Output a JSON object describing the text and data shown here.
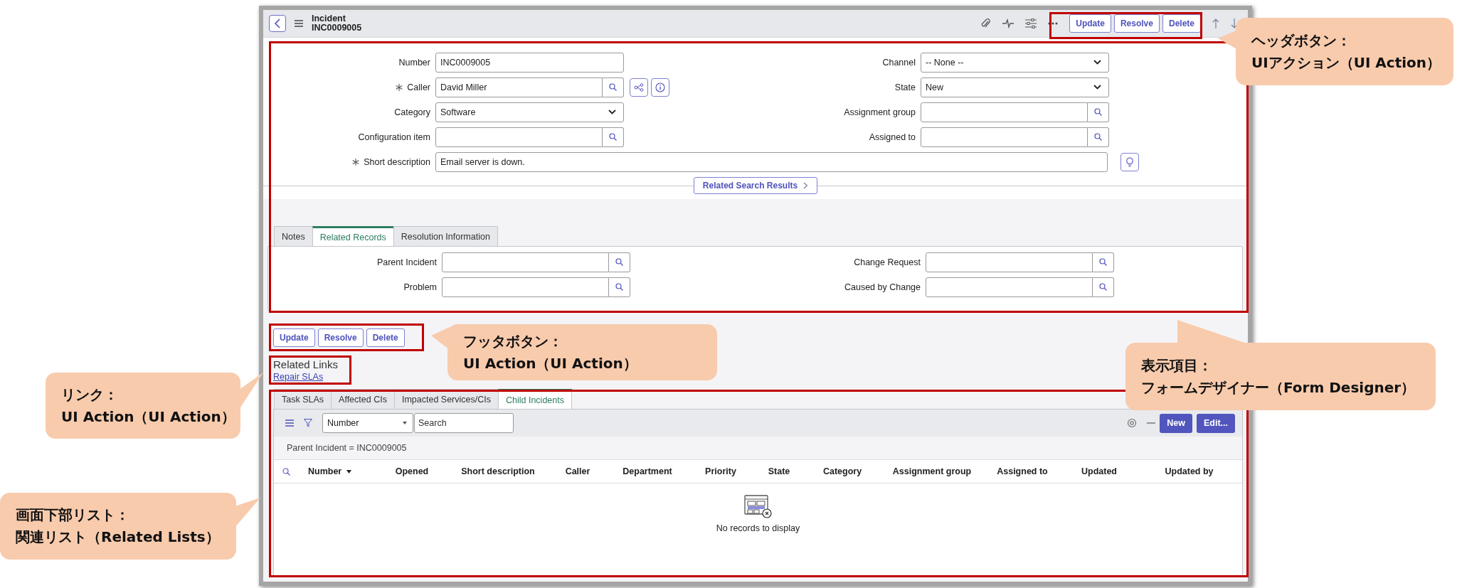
{
  "header": {
    "title": "Incident",
    "number": "INC0009005",
    "buttons": [
      "Update",
      "Resolve",
      "Delete"
    ]
  },
  "form": {
    "left": [
      {
        "label": "Number",
        "value": "INC0009005",
        "kind": "text",
        "required": false,
        "actions": false
      },
      {
        "label": "Caller",
        "value": "David Miller",
        "kind": "reference",
        "required": true,
        "actions": true
      },
      {
        "label": "Category",
        "value": "Software",
        "kind": "choice",
        "required": false,
        "actions": false
      },
      {
        "label": "Configuration item",
        "kind": "reference",
        "required": false,
        "actions": false
      }
    ],
    "right": [
      {
        "label": "Channel",
        "value": "-- None --",
        "kind": "choice",
        "required": false,
        "actions": false
      },
      {
        "label": "State",
        "value": "New",
        "kind": "choice",
        "required": false,
        "actions": false
      },
      {
        "label": "Assignment group",
        "kind": "reference",
        "required": false,
        "actions": false
      },
      {
        "label": "Assigned to",
        "kind": "reference",
        "required": false,
        "actions": false
      }
    ],
    "short_description": {
      "label": "Short description",
      "value": "Email server is down.",
      "required": true
    }
  },
  "related_search": "Related Search Results",
  "form_tabs": [
    {
      "label": "Notes",
      "selected": false
    },
    {
      "label": "Related Records",
      "selected": true
    },
    {
      "label": "Resolution Information",
      "selected": false
    }
  ],
  "tab_fields": {
    "left": [
      {
        "label": "Parent Incident",
        "kind": "reference",
        "required": false,
        "actions": false
      },
      {
        "label": "Problem",
        "kind": "reference",
        "required": false,
        "actions": false
      }
    ],
    "right": [
      {
        "label": "Change Request",
        "kind": "reference",
        "required": false,
        "actions": false
      },
      {
        "label": "Caused by Change",
        "kind": "reference",
        "required": false,
        "actions": false
      }
    ]
  },
  "footer_buttons": [
    "Update",
    "Resolve",
    "Delete"
  ],
  "related_links": {
    "title": "Related Links",
    "links": [
      "Repair SLAs"
    ]
  },
  "list_tabs": [
    {
      "label": "Task SLAs",
      "selected": false
    },
    {
      "label": "Affected CIs",
      "selected": false
    },
    {
      "label": "Impacted Services/CIs",
      "selected": false
    },
    {
      "label": "Child Incidents",
      "selected": true
    }
  ],
  "list": {
    "filter_field": "Number",
    "search_placeholder": "Search",
    "new_label": "New",
    "edit_label": "Edit...",
    "breadcrumb": "Parent Incident = INC0009005",
    "columns": [
      {
        "label": "Number",
        "sorted": true
      },
      {
        "label": "Opened",
        "sorted": false
      },
      {
        "label": "Short description",
        "sorted": false
      },
      {
        "label": "Caller",
        "sorted": false
      },
      {
        "label": "Department",
        "sorted": false
      },
      {
        "label": "Priority",
        "sorted": false
      },
      {
        "label": "State",
        "sorted": false
      },
      {
        "label": "Category",
        "sorted": false
      },
      {
        "label": "Assignment group",
        "sorted": false
      },
      {
        "label": "Assigned to",
        "sorted": false
      },
      {
        "label": "Updated",
        "sorted": false
      },
      {
        "label": "Updated by",
        "sorted": false
      }
    ],
    "empty_text": "No records to display"
  },
  "callouts": [
    {
      "kind": "header",
      "title": "ヘッダボタン：",
      "text": "UIアクション（UI Action）"
    },
    {
      "kind": "footer",
      "title": "フッタボタン：",
      "text": "UI Action（UI Action）"
    },
    {
      "kind": "form",
      "title": "表示項目：",
      "text": "フォームデザイナー（Form Designer）"
    },
    {
      "kind": "links",
      "title": "リンク：",
      "text": "UI Action（UI Action）"
    },
    {
      "kind": "lists",
      "title": "画面下部リスト：",
      "text": "関連リスト（Related Lists）"
    }
  ]
}
